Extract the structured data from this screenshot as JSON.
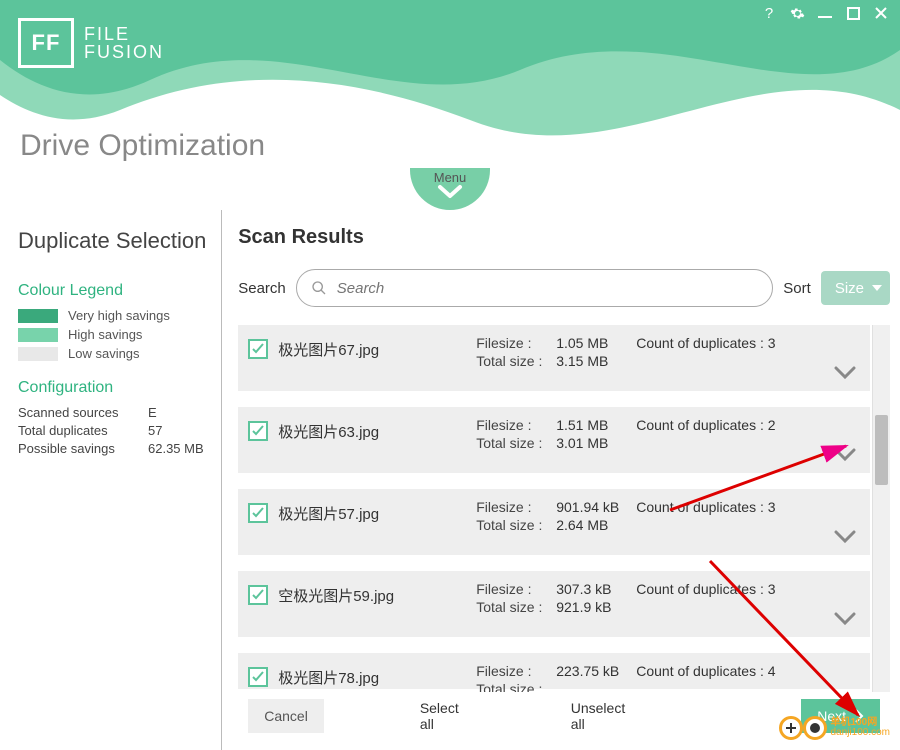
{
  "app": {
    "name_line1": "FILE",
    "name_line2": "FUSION",
    "logo_letters": "FF"
  },
  "page_title": "Drive Optimization",
  "menu_label": "Menu",
  "sidebar": {
    "title": "Duplicate Selection",
    "legend_title": "Colour Legend",
    "legend": [
      {
        "label": "Very high savings",
        "color": "#3aa97c"
      },
      {
        "label": "High savings",
        "color": "#78d3ab"
      },
      {
        "label": "Low savings",
        "color": "#e8e8e8"
      }
    ],
    "config_title": "Configuration",
    "config": [
      {
        "k": "Scanned sources",
        "v": "E"
      },
      {
        "k": "Total duplicates",
        "v": "57"
      },
      {
        "k": "Possible savings",
        "v": "62.35 MB"
      }
    ]
  },
  "main": {
    "title": "Scan Results",
    "search_label": "Search",
    "search_placeholder": "Search",
    "sort_label": "Sort",
    "sort_value": "Size",
    "rows": [
      {
        "name": "极光图片67.jpg",
        "fs_lbl": "Filesize :",
        "fs": "1.05 MB",
        "cnt_lbl": "Count of duplicates :",
        "cnt": "3",
        "ts_lbl": "Total size :",
        "ts": "3.15 MB"
      },
      {
        "name": "极光图片63.jpg",
        "fs_lbl": "Filesize :",
        "fs": "1.51 MB",
        "cnt_lbl": "Count of duplicates :",
        "cnt": "2",
        "ts_lbl": "Total size :",
        "ts": "3.01 MB"
      },
      {
        "name": "极光图片57.jpg",
        "fs_lbl": "Filesize :",
        "fs": "901.94 kB",
        "cnt_lbl": "Count of duplicates :",
        "cnt": "3",
        "ts_lbl": "Total size :",
        "ts": "2.64 MB"
      },
      {
        "name": "空极光图片59.jpg",
        "fs_lbl": "Filesize :",
        "fs": "307.3 kB",
        "cnt_lbl": "Count of duplicates :",
        "cnt": "3",
        "ts_lbl": "Total size :",
        "ts": "921.9 kB"
      },
      {
        "name": "极光图片78.jpg",
        "fs_lbl": "Filesize :",
        "fs": "223.75 kB",
        "cnt_lbl": "Count of duplicates :",
        "cnt": "4",
        "ts_lbl": "Total size :",
        "ts": ""
      }
    ]
  },
  "footer": {
    "cancel": "Cancel",
    "select_all": "Select all",
    "unselect_all": "Unselect all",
    "next": "Next"
  },
  "watermark": {
    "line1": "单机100网",
    "line2": "danji100.com"
  }
}
